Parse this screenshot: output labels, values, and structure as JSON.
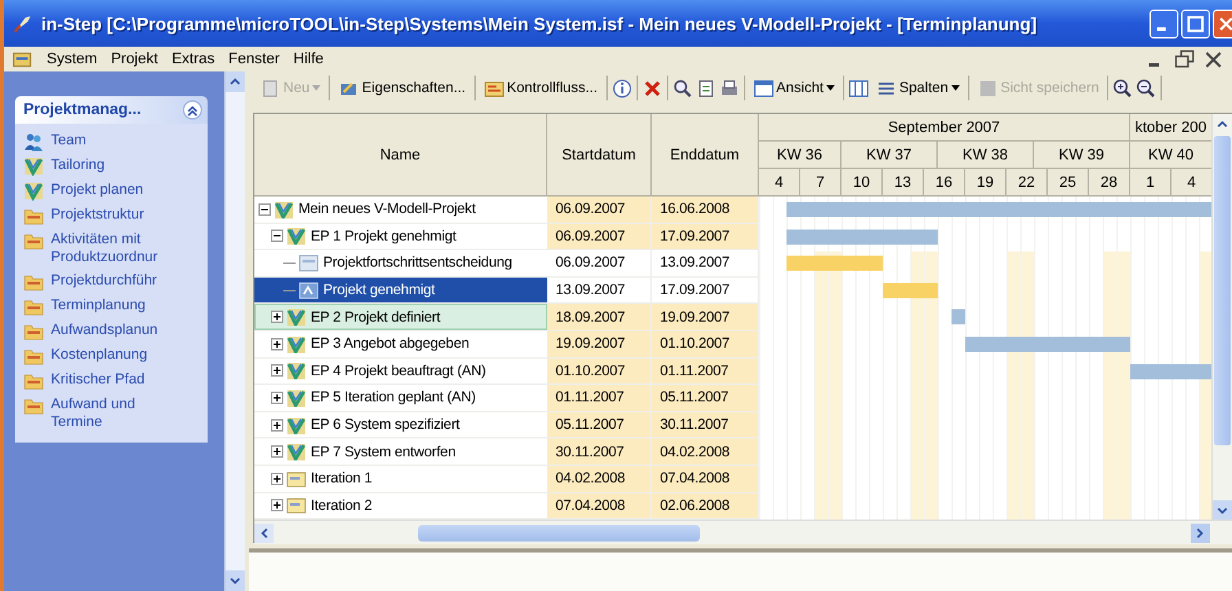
{
  "window": {
    "title": "in-Step  [C:\\Programme\\microTOOL\\in-Step\\Systems\\Mein System.isf - Mein neues V-Modell-Projekt - [Terminplanung]"
  },
  "menu": [
    "System",
    "Projekt",
    "Extras",
    "Fenster",
    "Hilfe"
  ],
  "sidebar": {
    "title": "Projektmanag...",
    "expanded": true,
    "items": [
      {
        "label": "Team",
        "kind": "team"
      },
      {
        "label": "Tailoring",
        "kind": "model"
      },
      {
        "label": "Projekt planen",
        "kind": "model"
      },
      {
        "label": "Projektstruktur",
        "kind": "view"
      },
      {
        "label": "Aktivitäten mit Produktzuordnur",
        "kind": "view"
      },
      {
        "label": "Projektdurchführ",
        "kind": "view"
      },
      {
        "label": "Terminplanung",
        "kind": "view"
      },
      {
        "label": "Aufwandsplanun",
        "kind": "view"
      },
      {
        "label": "Kostenplanung",
        "kind": "view"
      },
      {
        "label": "Kritischer Pfad",
        "kind": "view"
      },
      {
        "label": "Aufwand und Termine",
        "kind": "view"
      }
    ]
  },
  "toolbar": [
    {
      "items": [
        {
          "kind": "text",
          "label": "Neu",
          "dropdown": true,
          "disabled": true
        }
      ]
    },
    {
      "items": [
        {
          "kind": "text",
          "label": "Eigenschaften..."
        }
      ]
    },
    {
      "items": [
        {
          "kind": "text",
          "label": "Kontrollfluss..."
        }
      ]
    },
    {
      "items": [
        {
          "kind": "icon"
        }
      ]
    },
    {
      "items": [
        {
          "kind": "icon"
        }
      ]
    },
    {
      "items": [
        {
          "kind": "icon"
        },
        {
          "kind": "icon"
        },
        {
          "kind": "icon"
        }
      ]
    },
    {
      "items": [
        {
          "kind": "text",
          "label": "Ansicht",
          "dropdown": true
        }
      ]
    },
    {
      "items": [
        {
          "kind": "icon"
        },
        {
          "kind": "text",
          "label": "Spalten",
          "dropdown": true
        }
      ]
    },
    {
      "items": [
        {
          "kind": "text",
          "label": "Sicht speichern",
          "disabled": true
        }
      ]
    },
    {
      "items": [
        {
          "kind": "icon"
        },
        {
          "kind": "icon"
        }
      ]
    }
  ],
  "table": {
    "columns": [
      "Name",
      "Startdatum",
      "Enddatum"
    ],
    "timeline": {
      "months": [
        "September 2007",
        "ktober 200"
      ],
      "weeks": [
        "KW 36",
        "KW 37",
        "KW 38",
        "KW 39",
        "KW 40"
      ],
      "days": [
        "4",
        "7",
        "10",
        "13",
        "16",
        "19",
        "22",
        "25",
        "28",
        "1",
        "4"
      ]
    },
    "rows": [
      {
        "name": "Mein neues V-Modell-Projekt",
        "start": "06.09.2007",
        "end": "16.06.2008",
        "kind": "phase",
        "expanded": true,
        "selected": false,
        "hovered": false,
        "children": [
          {
            "name": "EP 1 Projekt genehmigt",
            "start": "06.09.2007",
            "end": "17.09.2007",
            "kind": "phase",
            "expanded": true,
            "selected": false,
            "hovered": false,
            "children": [
              {
                "name": "Projektfortschrittsentscheidung",
                "start": "06.09.2007",
                "end": "13.09.2007",
                "kind": "decision",
                "selected": false,
                "hovered": false
              },
              {
                "name": "Projekt genehmigt",
                "start": "13.09.2007",
                "end": "17.09.2007",
                "kind": "milestone",
                "selected": true,
                "hovered": false
              }
            ]
          },
          {
            "name": "EP 2 Projekt definiert",
            "start": "18.09.2007",
            "end": "19.09.2007",
            "kind": "phase",
            "expanded": false,
            "selected": false,
            "hovered": true
          },
          {
            "name": "EP 3 Angebot abgegeben",
            "start": "19.09.2007",
            "end": "01.10.2007",
            "kind": "phase",
            "expanded": false,
            "selected": false,
            "hovered": false
          },
          {
            "name": "EP 4 Projekt beauftragt (AN)",
            "start": "01.10.2007",
            "end": "01.11.2007",
            "kind": "phase",
            "expanded": false,
            "selected": false,
            "hovered": false
          },
          {
            "name": "EP 5 Iteration geplant (AN)",
            "start": "01.11.2007",
            "end": "05.11.2007",
            "kind": "phase",
            "expanded": false,
            "selected": false,
            "hovered": false
          },
          {
            "name": "EP 6 System spezifiziert",
            "start": "05.11.2007",
            "end": "30.11.2007",
            "kind": "phase",
            "expanded": false,
            "selected": false,
            "hovered": false
          },
          {
            "name": "EP 7 System entworfen",
            "start": "30.11.2007",
            "end": "04.02.2008",
            "kind": "phase",
            "expanded": false,
            "selected": false,
            "hovered": false
          },
          {
            "name": "Iteration 1",
            "start": "04.02.2008",
            "end": "07.04.2008",
            "kind": "iteration",
            "expanded": false,
            "selected": false,
            "hovered": false
          },
          {
            "name": "Iteration 2",
            "start": "07.04.2008",
            "end": "02.06.2008",
            "kind": "iteration",
            "expanded": false,
            "selected": false,
            "hovered": false
          }
        ]
      }
    ]
  }
}
